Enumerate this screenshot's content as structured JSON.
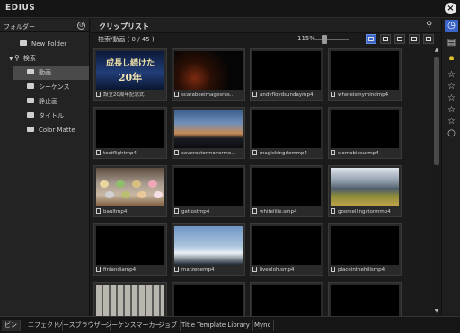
{
  "app": {
    "title": "EDIUS"
  },
  "folder_panel": {
    "header": "フォルダー",
    "tree": [
      {
        "label": "New Folder",
        "type": "folder"
      },
      {
        "label": "検索",
        "type": "search",
        "expanded": true
      },
      {
        "label": "動画",
        "type": "folder",
        "selected": true
      },
      {
        "label": "シーケンス",
        "type": "folder"
      },
      {
        "label": "静止画",
        "type": "folder"
      },
      {
        "label": "タイトル",
        "type": "folder"
      },
      {
        "label": "Color Matte",
        "type": "folder"
      }
    ]
  },
  "clip_list": {
    "title": "クリップリスト",
    "search_result": "検索/動画 ( 0 / 45 )",
    "zoom": "115%",
    "clips": [
      {
        "name": "設立20周年記念式",
        "thumb": "banner",
        "title_line1": "成長し続けた",
        "title_line2": "20年"
      },
      {
        "name": "scarabeeimagesrus…",
        "thumb": "night"
      },
      {
        "name": "andyfloydsundaymp4",
        "thumb": "black"
      },
      {
        "name": "whereismymindmp4",
        "thumb": "black"
      },
      {
        "name": "testflightmp4",
        "thumb": "black"
      },
      {
        "name": "severestormovermo…",
        "thumb": "sunset"
      },
      {
        "name": "magickingdommp4",
        "thumb": "black"
      },
      {
        "name": "slomobiesurmp4",
        "thumb": "black"
      },
      {
        "name": "baultmp4",
        "thumb": "cakes"
      },
      {
        "name": "getlostmp4",
        "thumb": "black"
      },
      {
        "name": "whitelilie.smp4",
        "thumb": "black"
      },
      {
        "name": "goomellingstormmp4",
        "thumb": "storm"
      },
      {
        "name": "finlandiamp4",
        "thumb": "black"
      },
      {
        "name": "marzenemp4",
        "thumb": "sky"
      },
      {
        "name": "liveoloh.smp4",
        "thumb": "black"
      },
      {
        "name": "placeinthehillsmp4",
        "thumb": "black"
      },
      {
        "name": "",
        "thumb": "building"
      },
      {
        "name": "",
        "thumb": "black"
      },
      {
        "name": "",
        "thumb": "black"
      },
      {
        "name": "",
        "thumb": "black"
      }
    ]
  },
  "bottom_tabs": [
    {
      "label": "ビン",
      "active": true
    },
    {
      "label": "エフェクト"
    },
    {
      "label": "ソースブラウザー"
    },
    {
      "label": "シーケンスマーカー"
    },
    {
      "label": "ジョブ"
    },
    {
      "label": "Title Template Library"
    },
    {
      "label": "Mync"
    }
  ],
  "icons": {
    "close": "close-icon",
    "search": "search-icon",
    "history": "history-icon",
    "accent": "#3a64c8"
  }
}
